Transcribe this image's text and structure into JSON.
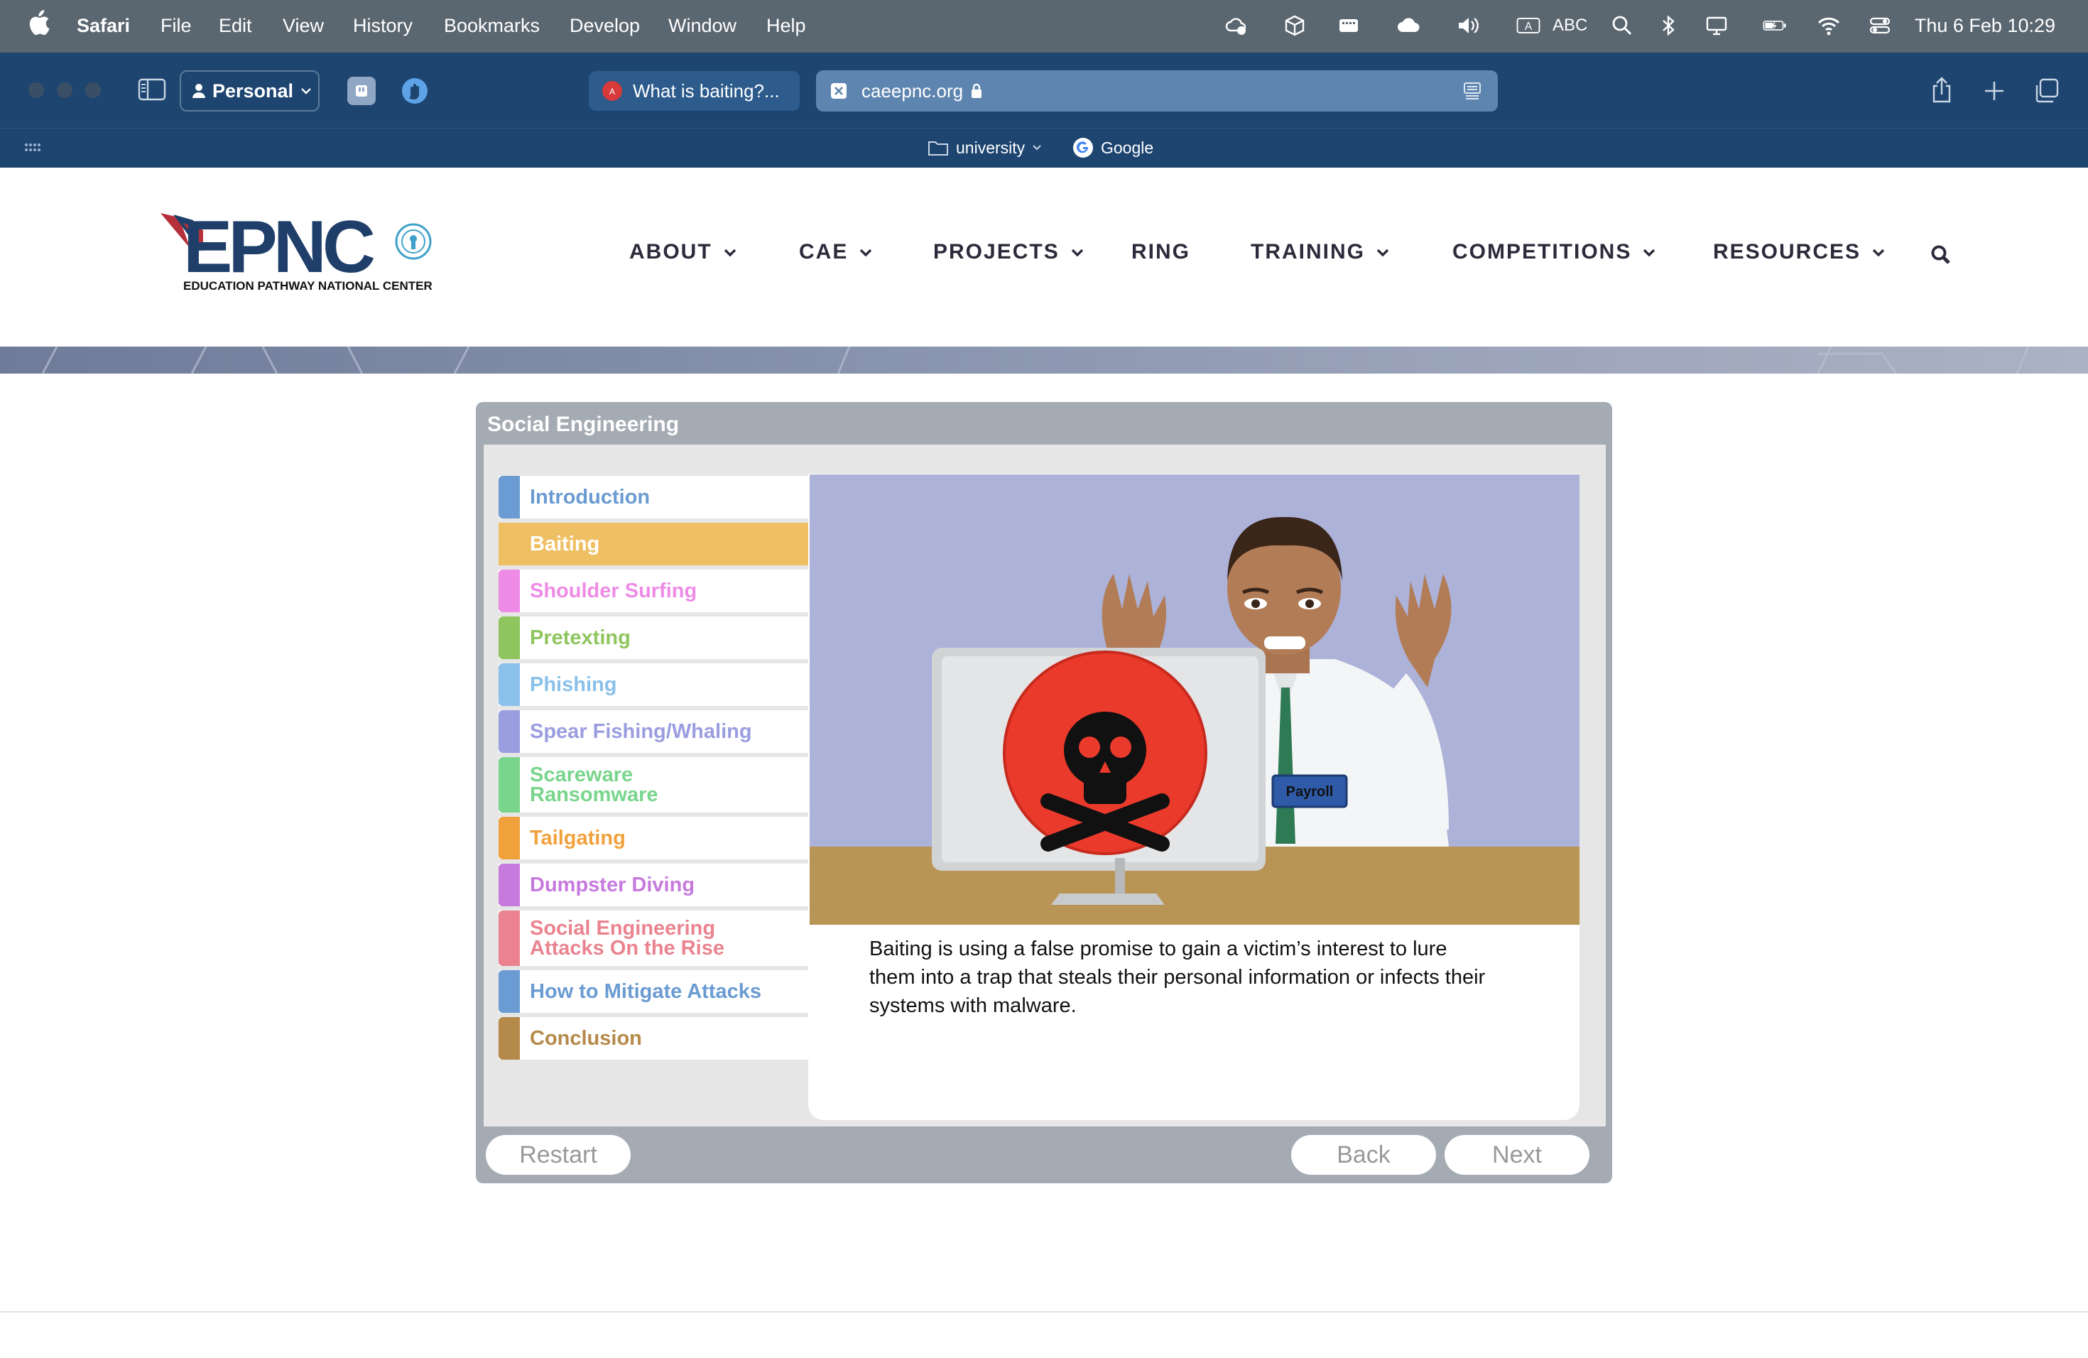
{
  "os_menubar": {
    "app_name": "Safari",
    "menus": [
      "File",
      "Edit",
      "View",
      "History",
      "Bookmarks",
      "Develop",
      "Window",
      "Help"
    ],
    "input_source": "ABC",
    "clock": "Thu 6 Feb  10:29"
  },
  "browser": {
    "profile": "Personal",
    "tabs": [
      {
        "title": "What is baiting?..."
      },
      {
        "title": "caeepnc.org"
      }
    ],
    "favorites": [
      {
        "label": "university"
      },
      {
        "label": "Google"
      }
    ]
  },
  "site": {
    "logo_text": "EPNC",
    "logo_subtitle": "EDUCATION PATHWAY NATIONAL CENTER",
    "nav": [
      "ABOUT",
      "CAE",
      "PROJECTS",
      "RING",
      "TRAINING",
      "COMPETITIONS",
      "RESOURCES"
    ],
    "nav_has_dropdown": [
      true,
      true,
      true,
      false,
      true,
      true,
      true
    ]
  },
  "course": {
    "title": "Social Engineering",
    "menu": [
      {
        "label": "Introduction",
        "color": "#6a9bd2"
      },
      {
        "label": "Baiting",
        "color": "#efc063",
        "selected": true
      },
      {
        "label": "Shoulder Surfing",
        "color": "#ee8be6"
      },
      {
        "label": "Pretexting",
        "color": "#8fc55e"
      },
      {
        "label": "Phishing",
        "color": "#8ac1ea"
      },
      {
        "label": "Spear Fishing/Whaling",
        "color": "#9a9ee0"
      },
      {
        "label": "Scareware Ransomware",
        "color": "#78d58b"
      },
      {
        "label": "Tailgating",
        "color": "#f1a13c"
      },
      {
        "label": "Dumpster Diving",
        "color": "#c67ade"
      },
      {
        "label": "Social Engineering Attacks On the Rise",
        "color": "#ea838f"
      },
      {
        "label": "How to Mitigate Attacks",
        "color": "#6a9bd2"
      },
      {
        "label": "Conclusion",
        "color": "#b5894a"
      }
    ],
    "badge_text": "Payroll",
    "description": "Baiting is using a false promise to gain a victim’s interest to lure them into a trap that steals their personal information or infects their systems with malware.",
    "buttons": {
      "restart": "Restart",
      "back": "Back",
      "next": "Next"
    }
  }
}
